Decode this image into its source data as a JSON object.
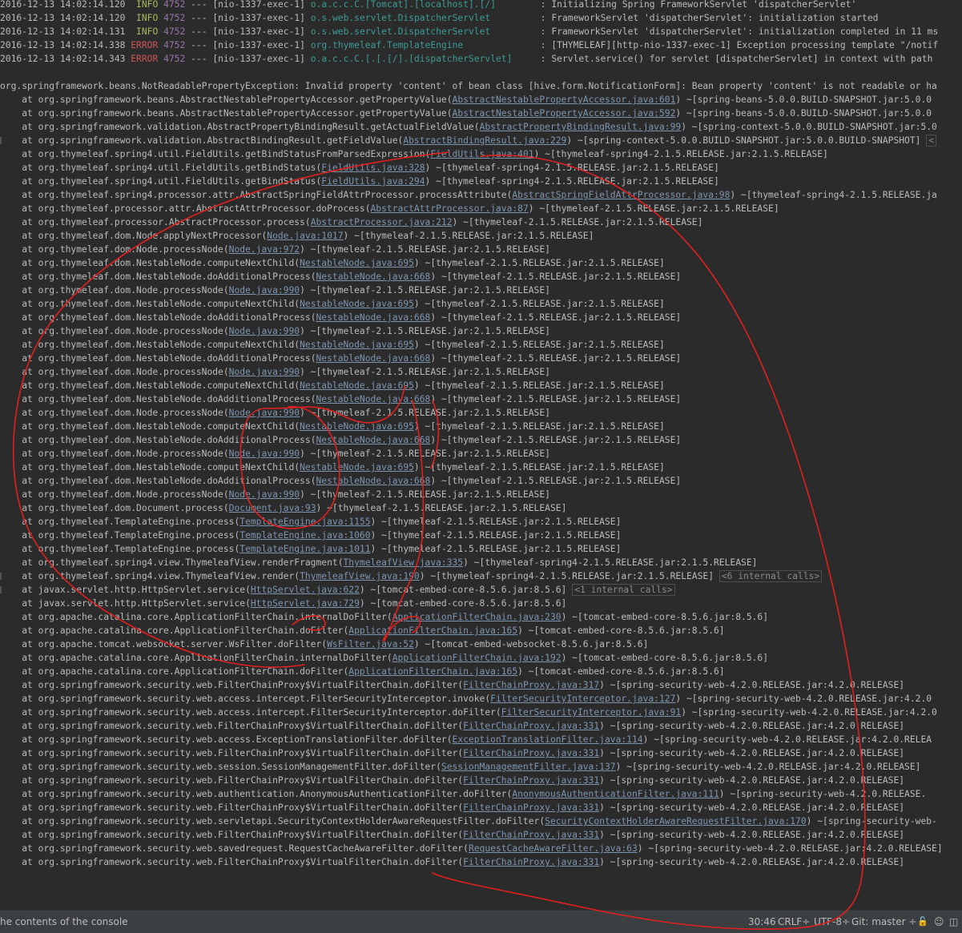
{
  "console": {
    "log_lines": [
      {
        "timestamp": "2016-12-13 14:02:14.120",
        "level": "INFO",
        "pid": "4752",
        "sep": "---",
        "thread": "[nio-1337-exec-1]",
        "logger": "o.a.c.c.C.[Tomcat].[localhost].[/]",
        "message": ": Initializing Spring FrameworkServlet 'dispatcherServlet'"
      },
      {
        "timestamp": "2016-12-13 14:02:14.120",
        "level": "INFO",
        "pid": "4752",
        "sep": "---",
        "thread": "[nio-1337-exec-1]",
        "logger": "o.s.web.servlet.DispatcherServlet",
        "message": ": FrameworkServlet 'dispatcherServlet': initialization started"
      },
      {
        "timestamp": "2016-12-13 14:02:14.131",
        "level": "INFO",
        "pid": "4752",
        "sep": "---",
        "thread": "[nio-1337-exec-1]",
        "logger": "o.s.web.servlet.DispatcherServlet",
        "message": ": FrameworkServlet 'dispatcherServlet': initialization completed in 11 ms"
      },
      {
        "timestamp": "2016-12-13 14:02:14.338",
        "level": "ERROR",
        "pid": "4752",
        "sep": "---",
        "thread": "[nio-1337-exec-1]",
        "logger": "org.thymeleaf.TemplateEngine",
        "message": ": [THYMELEAF][http-nio-1337-exec-1] Exception processing template \"/notif"
      },
      {
        "timestamp": "2016-12-13 14:02:14.343",
        "level": "ERROR",
        "pid": "4752",
        "sep": "---",
        "thread": "[nio-1337-exec-1]",
        "logger": "o.a.c.c.C.[.[.[/].[dispatcherServlet]",
        "message": ": Servlet.service() for servlet [dispatcherServlet] in context with path"
      }
    ],
    "exception_line": "org.springframework.beans.NotReadablePropertyException: Invalid property 'content' of bean class [hive.form.NotificationForm]: Bean property 'content' is not readable or ha",
    "stack_frames": [
      {
        "method": "org.springframework.beans.AbstractNestablePropertyAccessor.getPropertyValue",
        "source": "AbstractNestablePropertyAccessor.java:601",
        "jar": "~[spring-beans-5.0.0.BUILD-SNAPSHOT.jar:5.0.0",
        "hint": ""
      },
      {
        "method": "org.springframework.beans.AbstractNestablePropertyAccessor.getPropertyValue",
        "source": "AbstractNestablePropertyAccessor.java:592",
        "jar": "~[spring-beans-5.0.0.BUILD-SNAPSHOT.jar:5.0.0",
        "hint": ""
      },
      {
        "method": "org.springframework.validation.AbstractPropertyBindingResult.getActualFieldValue",
        "source": "AbstractPropertyBindingResult.java:99",
        "jar": "~[spring-context-5.0.0.BUILD-SNAPSHOT.jar:5.0",
        "hint": ""
      },
      {
        "method": "org.springframework.validation.AbstractBindingResult.getFieldValue",
        "source": "AbstractBindingResult.java:229",
        "jar": "~[spring-context-5.0.0.BUILD-SNAPSHOT.jar:5.0.0.BUILD-SNAPSHOT]",
        "hint": "<"
      },
      {
        "method": "org.thymeleaf.spring4.util.FieldUtils.getBindStatusFromParsedExpression",
        "source": "FieldUtils.java:401",
        "jar": "~[thymeleaf-spring4-2.1.5.RELEASE.jar:2.1.5.RELEASE]",
        "hint": ""
      },
      {
        "method": "org.thymeleaf.spring4.util.FieldUtils.getBindStatus",
        "source": "FieldUtils.java:328",
        "jar": "~[thymeleaf-spring4-2.1.5.RELEASE.jar:2.1.5.RELEASE]",
        "hint": ""
      },
      {
        "method": "org.thymeleaf.spring4.util.FieldUtils.getBindStatus",
        "source": "FieldUtils.java:294",
        "jar": "~[thymeleaf-spring4-2.1.5.RELEASE.jar:2.1.5.RELEASE]",
        "hint": ""
      },
      {
        "method": "org.thymeleaf.spring4.processor.attr.AbstractSpringFieldAttrProcessor.processAttribute",
        "source": "AbstractSpringFieldAttrProcessor.java:98",
        "jar": "~[thymeleaf-spring4-2.1.5.RELEASE.ja",
        "hint": ""
      },
      {
        "method": "org.thymeleaf.processor.attr.AbstractAttrProcessor.doProcess",
        "source": "AbstractAttrProcessor.java:87",
        "jar": "~[thymeleaf-2.1.5.RELEASE.jar:2.1.5.RELEASE]",
        "hint": ""
      },
      {
        "method": "org.thymeleaf.processor.AbstractProcessor.process",
        "source": "AbstractProcessor.java:212",
        "jar": "~[thymeleaf-2.1.5.RELEASE.jar:2.1.5.RELEASE]",
        "hint": ""
      },
      {
        "method": "org.thymeleaf.dom.Node.applyNextProcessor",
        "source": "Node.java:1017",
        "jar": "~[thymeleaf-2.1.5.RELEASE.jar:2.1.5.RELEASE]",
        "hint": ""
      },
      {
        "method": "org.thymeleaf.dom.Node.processNode",
        "source": "Node.java:972",
        "jar": "~[thymeleaf-2.1.5.RELEASE.jar:2.1.5.RELEASE]",
        "hint": ""
      },
      {
        "method": "org.thymeleaf.dom.NestableNode.computeNextChild",
        "source": "NestableNode.java:695",
        "jar": "~[thymeleaf-2.1.5.RELEASE.jar:2.1.5.RELEASE]",
        "hint": ""
      },
      {
        "method": "org.thymeleaf.dom.NestableNode.doAdditionalProcess",
        "source": "NestableNode.java:668",
        "jar": "~[thymeleaf-2.1.5.RELEASE.jar:2.1.5.RELEASE]",
        "hint": ""
      },
      {
        "method": "org.thymeleaf.dom.Node.processNode",
        "source": "Node.java:990",
        "jar": "~[thymeleaf-2.1.5.RELEASE.jar:2.1.5.RELEASE]",
        "hint": ""
      },
      {
        "method": "org.thymeleaf.dom.NestableNode.computeNextChild",
        "source": "NestableNode.java:695",
        "jar": "~[thymeleaf-2.1.5.RELEASE.jar:2.1.5.RELEASE]",
        "hint": ""
      },
      {
        "method": "org.thymeleaf.dom.NestableNode.doAdditionalProcess",
        "source": "NestableNode.java:668",
        "jar": "~[thymeleaf-2.1.5.RELEASE.jar:2.1.5.RELEASE]",
        "hint": ""
      },
      {
        "method": "org.thymeleaf.dom.Node.processNode",
        "source": "Node.java:990",
        "jar": "~[thymeleaf-2.1.5.RELEASE.jar:2.1.5.RELEASE]",
        "hint": ""
      },
      {
        "method": "org.thymeleaf.dom.NestableNode.computeNextChild",
        "source": "NestableNode.java:695",
        "jar": "~[thymeleaf-2.1.5.RELEASE.jar:2.1.5.RELEASE]",
        "hint": ""
      },
      {
        "method": "org.thymeleaf.dom.NestableNode.doAdditionalProcess",
        "source": "NestableNode.java:668",
        "jar": "~[thymeleaf-2.1.5.RELEASE.jar:2.1.5.RELEASE]",
        "hint": ""
      },
      {
        "method": "org.thymeleaf.dom.Node.processNode",
        "source": "Node.java:990",
        "jar": "~[thymeleaf-2.1.5.RELEASE.jar:2.1.5.RELEASE]",
        "hint": ""
      },
      {
        "method": "org.thymeleaf.dom.NestableNode.computeNextChild",
        "source": "NestableNode.java:695",
        "jar": "~[thymeleaf-2.1.5.RELEASE.jar:2.1.5.RELEASE]",
        "hint": ""
      },
      {
        "method": "org.thymeleaf.dom.NestableNode.doAdditionalProcess",
        "source": "NestableNode.java:668",
        "jar": "~[thymeleaf-2.1.5.RELEASE.jar:2.1.5.RELEASE]",
        "hint": ""
      },
      {
        "method": "org.thymeleaf.dom.Node.processNode",
        "source": "Node.java:990",
        "jar": "~[thymeleaf-2.1.5.RELEASE.jar:2.1.5.RELEASE]",
        "hint": ""
      },
      {
        "method": "org.thymeleaf.dom.NestableNode.computeNextChild",
        "source": "NestableNode.java:695",
        "jar": "~[thymeleaf-2.1.5.RELEASE.jar:2.1.5.RELEASE]",
        "hint": ""
      },
      {
        "method": "org.thymeleaf.dom.NestableNode.doAdditionalProcess",
        "source": "NestableNode.java:668",
        "jar": "~[thymeleaf-2.1.5.RELEASE.jar:2.1.5.RELEASE]",
        "hint": ""
      },
      {
        "method": "org.thymeleaf.dom.Node.processNode",
        "source": "Node.java:990",
        "jar": "~[thymeleaf-2.1.5.RELEASE.jar:2.1.5.RELEASE]",
        "hint": ""
      },
      {
        "method": "org.thymeleaf.dom.NestableNode.computeNextChild",
        "source": "NestableNode.java:695",
        "jar": "~[thymeleaf-2.1.5.RELEASE.jar:2.1.5.RELEASE]",
        "hint": ""
      },
      {
        "method": "org.thymeleaf.dom.NestableNode.doAdditionalProcess",
        "source": "NestableNode.java:668",
        "jar": "~[thymeleaf-2.1.5.RELEASE.jar:2.1.5.RELEASE]",
        "hint": ""
      },
      {
        "method": "org.thymeleaf.dom.Node.processNode",
        "source": "Node.java:990",
        "jar": "~[thymeleaf-2.1.5.RELEASE.jar:2.1.5.RELEASE]",
        "hint": ""
      },
      {
        "method": "org.thymeleaf.dom.Document.process",
        "source": "Document.java:93",
        "jar": "~[thymeleaf-2.1.5.RELEASE.jar:2.1.5.RELEASE]",
        "hint": ""
      },
      {
        "method": "org.thymeleaf.TemplateEngine.process",
        "source": "TemplateEngine.java:1155",
        "jar": "~[thymeleaf-2.1.5.RELEASE.jar:2.1.5.RELEASE]",
        "hint": ""
      },
      {
        "method": "org.thymeleaf.TemplateEngine.process",
        "source": "TemplateEngine.java:1060",
        "jar": "~[thymeleaf-2.1.5.RELEASE.jar:2.1.5.RELEASE]",
        "hint": ""
      },
      {
        "method": "org.thymeleaf.TemplateEngine.process",
        "source": "TemplateEngine.java:1011",
        "jar": "~[thymeleaf-2.1.5.RELEASE.jar:2.1.5.RELEASE]",
        "hint": ""
      },
      {
        "method": "org.thymeleaf.spring4.view.ThymeleafView.renderFragment",
        "source": "ThymeleafView.java:335",
        "jar": "~[thymeleaf-spring4-2.1.5.RELEASE.jar:2.1.5.RELEASE]",
        "hint": ""
      },
      {
        "method": "org.thymeleaf.spring4.view.ThymeleafView.render",
        "source": "ThymeleafView.java:190",
        "jar": "~[thymeleaf-spring4-2.1.5.RELEASE.jar:2.1.5.RELEASE]",
        "hint": "<6 internal calls>"
      },
      {
        "method": "javax.servlet.http.HttpServlet.service",
        "source": "HttpServlet.java:622",
        "jar": "~[tomcat-embed-core-8.5.6.jar:8.5.6]",
        "hint": "<1 internal calls>"
      },
      {
        "method": "javax.servlet.http.HttpServlet.service",
        "source": "HttpServlet.java:729",
        "jar": "~[tomcat-embed-core-8.5.6.jar:8.5.6]",
        "hint": ""
      },
      {
        "method": "org.apache.catalina.core.ApplicationFilterChain.internalDoFilter",
        "source": "ApplicationFilterChain.java:230",
        "jar": "~[tomcat-embed-core-8.5.6.jar:8.5.6]",
        "hint": ""
      },
      {
        "method": "org.apache.catalina.core.ApplicationFilterChain.doFilter",
        "source": "ApplicationFilterChain.java:165",
        "jar": "~[tomcat-embed-core-8.5.6.jar:8.5.6]",
        "hint": ""
      },
      {
        "method": "org.apache.tomcat.websocket.server.WsFilter.doFilter",
        "source": "WsFilter.java:52",
        "jar": "~[tomcat-embed-websocket-8.5.6.jar:8.5.6]",
        "hint": ""
      },
      {
        "method": "org.apache.catalina.core.ApplicationFilterChain.internalDoFilter",
        "source": "ApplicationFilterChain.java:192",
        "jar": "~[tomcat-embed-core-8.5.6.jar:8.5.6]",
        "hint": ""
      },
      {
        "method": "org.apache.catalina.core.ApplicationFilterChain.doFilter",
        "source": "ApplicationFilterChain.java:165",
        "jar": "~[tomcat-embed-core-8.5.6.jar:8.5.6]",
        "hint": ""
      },
      {
        "method": "org.springframework.security.web.FilterChainProxy$VirtualFilterChain.doFilter",
        "source": "FilterChainProxy.java:317",
        "jar": "~[spring-security-web-4.2.0.RELEASE.jar:4.2.0.RELEASE]",
        "hint": ""
      },
      {
        "method": "org.springframework.security.web.access.intercept.FilterSecurityInterceptor.invoke",
        "source": "FilterSecurityInterceptor.java:127",
        "jar": "~[spring-security-web-4.2.0.RELEASE.jar:4.2.0",
        "hint": ""
      },
      {
        "method": "org.springframework.security.web.access.intercept.FilterSecurityInterceptor.doFilter",
        "source": "FilterSecurityInterceptor.java:91",
        "jar": "~[spring-security-web-4.2.0.RELEASE.jar:4.2.0",
        "hint": ""
      },
      {
        "method": "org.springframework.security.web.FilterChainProxy$VirtualFilterChain.doFilter",
        "source": "FilterChainProxy.java:331",
        "jar": "~[spring-security-web-4.2.0.RELEASE.jar:4.2.0.RELEASE]",
        "hint": ""
      },
      {
        "method": "org.springframework.security.web.access.ExceptionTranslationFilter.doFilter",
        "source": "ExceptionTranslationFilter.java:114",
        "jar": "~[spring-security-web-4.2.0.RELEASE.jar:4.2.0.RELEA",
        "hint": ""
      },
      {
        "method": "org.springframework.security.web.FilterChainProxy$VirtualFilterChain.doFilter",
        "source": "FilterChainProxy.java:331",
        "jar": "~[spring-security-web-4.2.0.RELEASE.jar:4.2.0.RELEASE]",
        "hint": ""
      },
      {
        "method": "org.springframework.security.web.session.SessionManagementFilter.doFilter",
        "source": "SessionManagementFilter.java:137",
        "jar": "~[spring-security-web-4.2.0.RELEASE.jar:4.2.0.RELEASE]",
        "hint": ""
      },
      {
        "method": "org.springframework.security.web.FilterChainProxy$VirtualFilterChain.doFilter",
        "source": "FilterChainProxy.java:331",
        "jar": "~[spring-security-web-4.2.0.RELEASE.jar:4.2.0.RELEASE]",
        "hint": ""
      },
      {
        "method": "org.springframework.security.web.authentication.AnonymousAuthenticationFilter.doFilter",
        "source": "AnonymousAuthenticationFilter.java:111",
        "jar": "~[spring-security-web-4.2.0.RELEASE.",
        "hint": ""
      },
      {
        "method": "org.springframework.security.web.FilterChainProxy$VirtualFilterChain.doFilter",
        "source": "FilterChainProxy.java:331",
        "jar": "~[spring-security-web-4.2.0.RELEASE.jar:4.2.0.RELEASE]",
        "hint": ""
      },
      {
        "method": "org.springframework.security.web.servletapi.SecurityContextHolderAwareRequestFilter.doFilter",
        "source": "SecurityContextHolderAwareRequestFilter.java:170",
        "jar": "~[spring-security-web-",
        "hint": ""
      },
      {
        "method": "org.springframework.security.web.FilterChainProxy$VirtualFilterChain.doFilter",
        "source": "FilterChainProxy.java:331",
        "jar": "~[spring-security-web-4.2.0.RELEASE.jar:4.2.0.RELEASE]",
        "hint": ""
      },
      {
        "method": "org.springframework.security.web.savedrequest.RequestCacheAwareFilter.doFilter",
        "source": "RequestCacheAwareFilter.java:63",
        "jar": "~[spring-security-web-4.2.0.RELEASE.jar:4.2.0.RELEASE]",
        "hint": ""
      },
      {
        "method": "org.springframework.security.web.FilterChainProxy$VirtualFilterChain.doFilter",
        "source": "FilterChainProxy.java:331",
        "jar": "~[spring-security-web-4.2.0.RELEASE.jar:4.2.0.RELEASE]",
        "hint": ""
      }
    ]
  },
  "status_bar": {
    "message": "he contents of the console",
    "caret_position": "30:46",
    "line_separator": "CRLF÷",
    "encoding": "UTF-8÷",
    "vcs_branch": "Git: master ÷",
    "lock_glyph": "🔓",
    "inspector_glyph": "☺",
    "memory_glyph": "◫"
  },
  "colors": {
    "background": "#2b2b2b",
    "info": "#a9b75e",
    "error": "#cc5555",
    "pid": "#9876aa",
    "logger": "#3d9b93",
    "link": "#7e95b0",
    "annotation": "#e02020"
  },
  "icons": [
    "lock-icon",
    "inspector-icon",
    "memory-icon"
  ]
}
